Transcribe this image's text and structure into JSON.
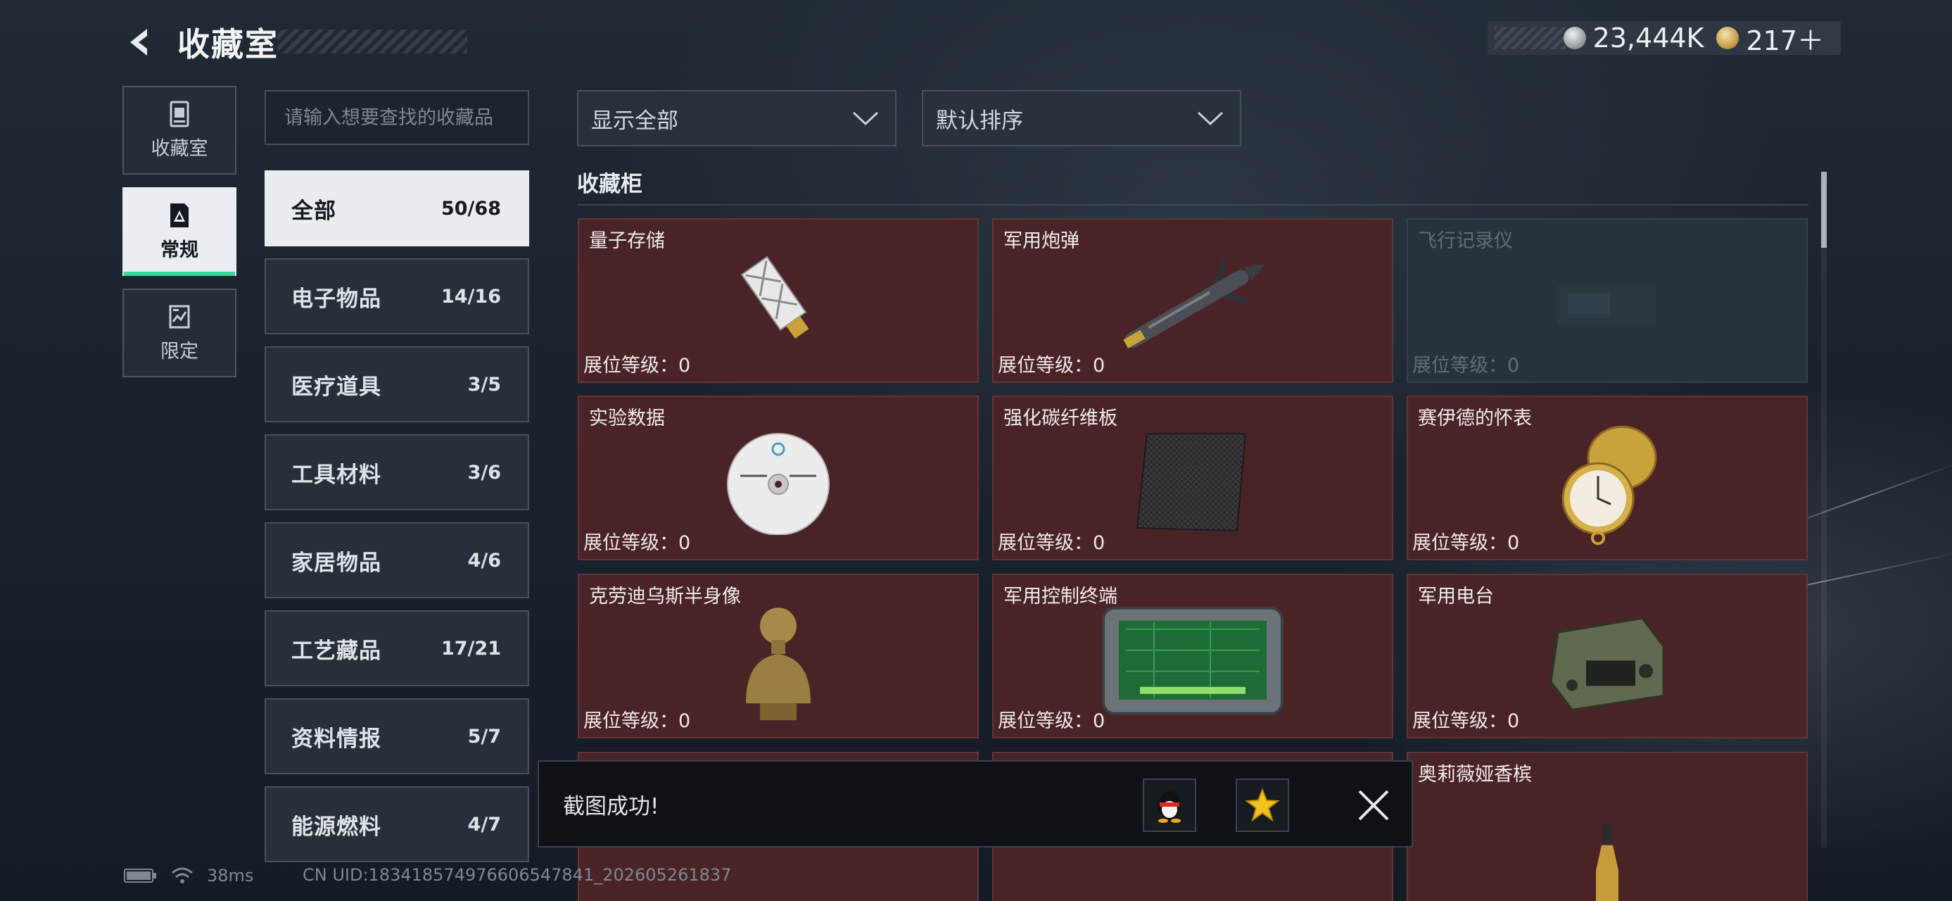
{
  "header": {
    "title": "收藏室"
  },
  "currency": {
    "silver": "23,444K",
    "gold": "217＋"
  },
  "rail": [
    {
      "label": "收藏室",
      "icon": "trophy-cabinet-icon"
    },
    {
      "label": "常规",
      "icon": "regular-collection-icon"
    },
    {
      "label": "限定",
      "icon": "limited-collection-icon"
    }
  ],
  "search": {
    "placeholder": "请输入想要查找的收藏品"
  },
  "categories": [
    {
      "name": "全部",
      "count": "50/68"
    },
    {
      "name": "电子物品",
      "count": "14/16"
    },
    {
      "name": "医疗道具",
      "count": "3/5"
    },
    {
      "name": "工具材料",
      "count": "3/6"
    },
    {
      "name": "家居物品",
      "count": "4/6"
    },
    {
      "name": "工艺藏品",
      "count": "17/21"
    },
    {
      "name": "资料情报",
      "count": "5/7"
    },
    {
      "name": "能源燃料",
      "count": "4/7"
    }
  ],
  "filters": {
    "display": "显示全部",
    "sort": "默认排序"
  },
  "section": {
    "title": "收藏柜"
  },
  "items": [
    {
      "name": "量子存储",
      "level": "展位等级：0",
      "icon": "usb-drive-icon"
    },
    {
      "name": "军用炮弹",
      "level": "展位等级：0",
      "icon": "missile-icon"
    },
    {
      "name": "飞行记录仪",
      "level": "展位等级：0",
      "icon": "flight-recorder-icon"
    },
    {
      "name": "实验数据",
      "level": "展位等级：0",
      "icon": "disc-icon"
    },
    {
      "name": "强化碳纤维板",
      "level": "展位等级：0",
      "icon": "carbon-plate-icon"
    },
    {
      "name": "赛伊德的怀表",
      "level": "展位等级：0",
      "icon": "pocket-watch-icon"
    },
    {
      "name": "克劳迪乌斯半身像",
      "level": "展位等级：0",
      "icon": "bust-icon"
    },
    {
      "name": "军用控制终端",
      "level": "展位等级：0",
      "icon": "control-terminal-icon"
    },
    {
      "name": "军用电台",
      "level": "展位等级：0",
      "icon": "radio-icon"
    },
    {
      "name": "",
      "level": "",
      "icon": ""
    },
    {
      "name": "",
      "level": "",
      "icon": ""
    },
    {
      "name": "奥莉薇娅香槟",
      "level": "",
      "icon": "champagne-icon"
    }
  ],
  "toast": {
    "message": "截图成功!"
  },
  "status": {
    "ping": "38ms",
    "uid": "CN UID:1834185749766065478​41_202605261837"
  },
  "colors": {
    "owned_card": "#4a2327",
    "locked_card": "#26333b",
    "active_tab": "#e9edf1",
    "accent": "#39d69a"
  }
}
